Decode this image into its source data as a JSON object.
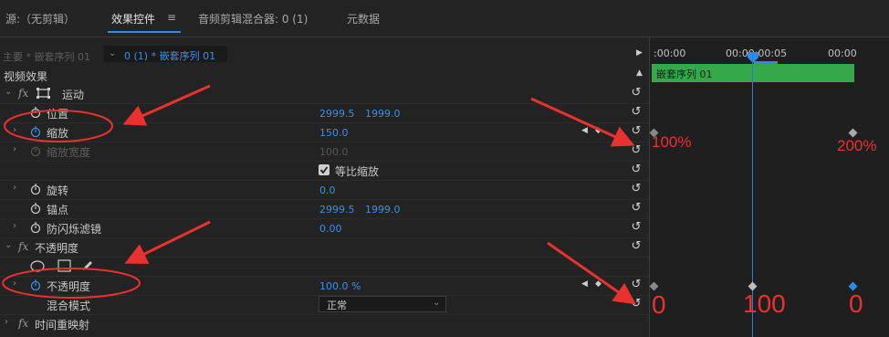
{
  "tabs": {
    "source": "源:（无剪辑）",
    "effect_controls": "效果控件",
    "menu_glyph": "≡",
    "audio_mixer": "音频剪辑混合器: 0 (1)",
    "metadata": "元数据"
  },
  "header": {
    "master": "主要 * 嵌套序列 01",
    "sequence": "0 (1) * 嵌套序列 01"
  },
  "section_label": "视频效果",
  "timeline": {
    "time_left": ":00:00",
    "time_mid": "00:00:00:05",
    "time_right": "00:00",
    "clip_name": "嵌套序列 01"
  },
  "effects": {
    "motion": {
      "fx": "fx",
      "name": "运动",
      "position": {
        "label": "位置",
        "x": "2999.5",
        "y": "1999.0"
      },
      "scale": {
        "label": "缩放",
        "value": "150.0"
      },
      "scale_width": {
        "label": "缩放宽度",
        "value": "100.0"
      },
      "uniform_scale": {
        "label": "等比缩放",
        "checked": true
      },
      "rotation": {
        "label": "旋转",
        "value": "0.0"
      },
      "anchor": {
        "label": "锚点",
        "x": "2999.5",
        "y": "1999.0"
      },
      "anti_flicker": {
        "label": "防闪烁滤镜",
        "value": "0.00"
      }
    },
    "opacity": {
      "fx": "fx",
      "name": "不透明度",
      "opacity": {
        "label": "不透明度",
        "value": "100.0 %"
      },
      "blend_mode": {
        "label": "混合模式",
        "value": "正常"
      }
    },
    "time_remap": {
      "fx": "fx",
      "name": "时间重映射"
    }
  },
  "annotations": {
    "scale_start": "100%",
    "scale_end": "200%",
    "opacity_start": "0",
    "opacity_mid": "100",
    "opacity_end": "0"
  },
  "colors": {
    "accent_blue": "#3d8ee6",
    "clip_green": "#35a84b",
    "annotation_red": "#e8322f"
  }
}
